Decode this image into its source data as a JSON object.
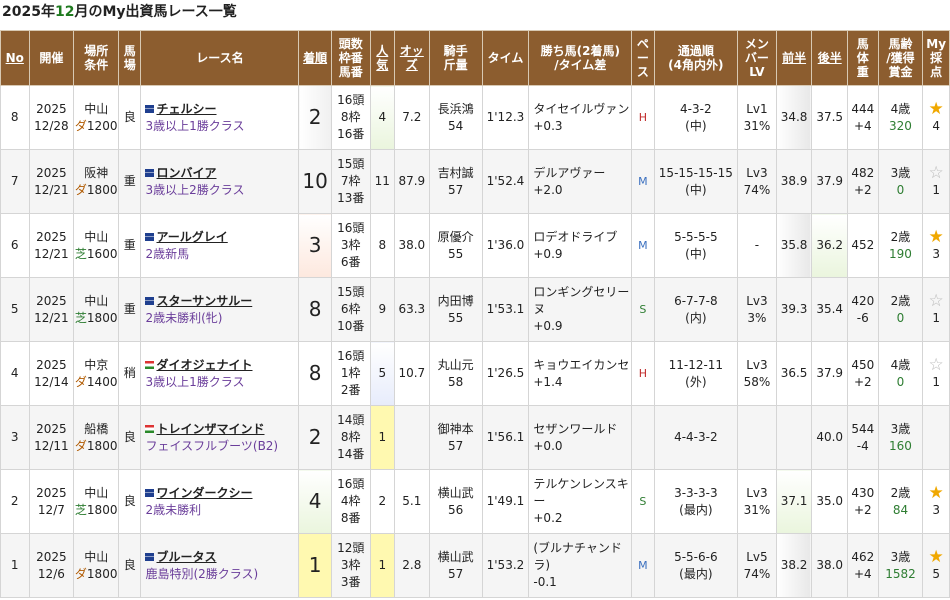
{
  "page": {
    "title_prefix": "2025年",
    "title_month": "12",
    "title_suffix": "月のMy出資馬レース一覧"
  },
  "headers": [
    "No",
    "開催",
    "場所\n条件",
    "馬\n場",
    "レース名",
    "着順",
    "頭数\n枠番\n馬番",
    "人\n気",
    "オッ\nズ",
    "騎手\n斤量",
    "タイム",
    "勝ち馬(2着馬)\n/タイム差",
    "ペ\nー\nス",
    "通過順\n(4角内外)",
    "メン\nバー\nLV",
    "前半",
    "後半",
    "馬\n体\n重",
    "馬齢\n/獲得\n賞金",
    "My\n採\n点"
  ],
  "rows": [
    {
      "no": "8",
      "year": "2025",
      "date": "12/28",
      "place": "中山",
      "surface": "ダ",
      "dist": "1200",
      "baba": "良",
      "flag": "blue",
      "name": "チェルシー",
      "cls": "3歳以上1勝クラス",
      "chaku": "2",
      "chaku_bg": "grad",
      "tosu": "16頭",
      "waku": "8枠",
      "uma": "16番",
      "ninki": "4",
      "ninki_bg": "lg",
      "odds": "7.2",
      "jockey": "長浜鴻",
      "kinryo": "54",
      "time": "1'12.3",
      "winner": "タイセイルヴァン",
      "diff": "+0.3",
      "pace": "H",
      "tsuka": "4-3-2",
      "naigai": "(中)",
      "lv": "Lv1",
      "lvp": "31%",
      "zen": "34.8",
      "zen_bg": "dg",
      "kou": "37.5",
      "kou_bg": "",
      "weight": "444",
      "wdiff": "+4",
      "age": "4歳",
      "prize": "320",
      "star": "full",
      "score": "4"
    },
    {
      "no": "7",
      "year": "2025",
      "date": "12/21",
      "place": "阪神",
      "surface": "ダ",
      "dist": "1800",
      "baba": "重",
      "flag": "blue",
      "name": "ロンバイア",
      "cls": "3歳以上2勝クラス",
      "chaku": "10",
      "chaku_bg": "",
      "tosu": "15頭",
      "waku": "7枠",
      "uma": "13番",
      "ninki": "11",
      "ninki_bg": "",
      "odds": "87.9",
      "jockey": "吉村誠",
      "kinryo": "57",
      "time": "1'52.4",
      "winner": "デルアヴァー",
      "diff": "+2.0",
      "pace": "M",
      "tsuka": "15-15-15-15",
      "naigai": "(中)",
      "lv": "Lv3",
      "lvp": "74%",
      "zen": "38.9",
      "zen_bg": "",
      "kou": "37.9",
      "kou_bg": "",
      "weight": "482",
      "wdiff": "+2",
      "age": "3歳",
      "prize": "0",
      "star": "empty",
      "score": "1"
    },
    {
      "no": "6",
      "year": "2025",
      "date": "12/21",
      "place": "中山",
      "surface": "芝",
      "dist": "1600",
      "baba": "重",
      "flag": "blue",
      "name": "アールグレイ",
      "cls": "2歳新馬",
      "chaku": "3",
      "chaku_bg": "pink",
      "tosu": "16頭",
      "waku": "3枠",
      "uma": "6番",
      "ninki": "8",
      "ninki_bg": "",
      "odds": "38.0",
      "jockey": "原優介",
      "kinryo": "55",
      "time": "1'36.0",
      "winner": "ロデオドライブ",
      "diff": "+0.9",
      "pace": "M",
      "tsuka": "5-5-5-5",
      "naigai": "(中)",
      "lv": "-",
      "lvp": "",
      "zen": "35.8",
      "zen_bg": "dg",
      "kou": "36.2",
      "kou_bg": "lg",
      "weight": "452",
      "wdiff": "",
      "age": "2歳",
      "prize": "190",
      "star": "half",
      "score": "3"
    },
    {
      "no": "5",
      "year": "2025",
      "date": "12/21",
      "place": "中山",
      "surface": "芝",
      "dist": "1800",
      "baba": "重",
      "flag": "blue",
      "name": "スターサンサルー",
      "cls": "2歳未勝利(牝)",
      "chaku": "8",
      "chaku_bg": "",
      "tosu": "15頭",
      "waku": "6枠",
      "uma": "10番",
      "ninki": "9",
      "ninki_bg": "",
      "odds": "63.3",
      "jockey": "内田博",
      "kinryo": "55",
      "time": "1'53.1",
      "winner": "ロンギングセリーヌ",
      "diff": "+0.9",
      "pace": "S",
      "tsuka": "6-7-7-8",
      "naigai": "(内)",
      "lv": "Lv3",
      "lvp": "3%",
      "zen": "39.3",
      "zen_bg": "",
      "kou": "35.4",
      "kou_bg": "",
      "weight": "420",
      "wdiff": "-6",
      "age": "2歳",
      "prize": "0",
      "star": "empty",
      "score": "1"
    },
    {
      "no": "4",
      "year": "2025",
      "date": "12/14",
      "place": "中京",
      "surface": "ダ",
      "dist": "1400",
      "baba": "稍",
      "flag": "hu",
      "name": "ダイオジェナイト",
      "cls": "3歳以上1勝クラス",
      "chaku": "8",
      "chaku_bg": "",
      "tosu": "16頭",
      "waku": "1枠",
      "uma": "2番",
      "ninki": "5",
      "ninki_bg": "blu",
      "odds": "10.7",
      "jockey": "丸山元",
      "kinryo": "58",
      "time": "1'26.5",
      "winner": "キョウエイカンセ",
      "diff": "+1.4",
      "pace": "H",
      "tsuka": "11-12-11",
      "naigai": "(外)",
      "lv": "Lv3",
      "lvp": "58%",
      "zen": "36.5",
      "zen_bg": "",
      "kou": "37.9",
      "kou_bg": "",
      "weight": "450",
      "wdiff": "+2",
      "age": "4歳",
      "prize": "0",
      "star": "empty",
      "score": "1"
    },
    {
      "no": "3",
      "year": "2025",
      "date": "12/11",
      "place": "船橋",
      "surface": "ダ",
      "dist": "1800",
      "baba": "良",
      "flag": "hu",
      "name": "トレインザマインド",
      "cls": "フェイスフルブーツ(B2)",
      "chaku": "2",
      "chaku_bg": "",
      "tosu": "14頭",
      "waku": "8枠",
      "uma": "14番",
      "ninki": "1",
      "ninki_bg": "gold",
      "odds": "",
      "jockey": "御神本",
      "kinryo": "57",
      "time": "1'56.1",
      "winner": "セザンワールド",
      "diff": "+0.0",
      "pace": "",
      "tsuka": "4-4-3-2",
      "naigai": "",
      "lv": "",
      "lvp": "",
      "zen": "",
      "zen_bg": "",
      "kou": "40.0",
      "kou_bg": "",
      "weight": "544",
      "wdiff": "-4",
      "age": "3歳",
      "prize": "160",
      "star": "",
      "score": ""
    },
    {
      "no": "2",
      "year": "2025",
      "date": "12/7",
      "place": "中山",
      "surface": "芝",
      "dist": "1800",
      "baba": "良",
      "flag": "blue",
      "name": "ワインダークシー",
      "cls": "2歳未勝利",
      "chaku": "4",
      "chaku_bg": "lg",
      "tosu": "16頭",
      "waku": "4枠",
      "uma": "8番",
      "ninki": "2",
      "ninki_bg": "",
      "odds": "5.1",
      "jockey": "横山武",
      "kinryo": "56",
      "time": "1'49.1",
      "winner": "テルケンレンスキー",
      "diff": "+0.2",
      "pace": "S",
      "tsuka": "3-3-3-3",
      "naigai": "(最内)",
      "lv": "Lv3",
      "lvp": "31%",
      "zen": "37.1",
      "zen_bg": "lg",
      "kou": "35.0",
      "kou_bg": "",
      "weight": "430",
      "wdiff": "+2",
      "age": "2歳",
      "prize": "84",
      "star": "half",
      "score": "3"
    },
    {
      "no": "1",
      "year": "2025",
      "date": "12/6",
      "place": "中山",
      "surface": "ダ",
      "dist": "1800",
      "baba": "良",
      "flag": "blue",
      "name": "ブルータス",
      "cls": "鹿島特別(2勝クラス)",
      "chaku": "1",
      "chaku_bg": "gold",
      "tosu": "12頭",
      "waku": "3枠",
      "uma": "3番",
      "ninki": "1",
      "ninki_bg": "gold",
      "odds": "2.8",
      "jockey": "横山武",
      "kinryo": "57",
      "time": "1'53.2",
      "winner": "(ブルナチャンドラ)",
      "diff": "-0.1",
      "pace": "M",
      "tsuka": "5-5-6-6",
      "naigai": "(最内)",
      "lv": "Lv5",
      "lvp": "74%",
      "zen": "38.2",
      "zen_bg": "dg",
      "kou": "38.0",
      "kou_bg": "",
      "weight": "462",
      "wdiff": "+4",
      "age": "3歳",
      "prize": "1582",
      "star": "full",
      "score": "5"
    }
  ],
  "icons": {
    "star-full": "★",
    "star-empty": "☆"
  },
  "colors": {
    "header_bg": "#8c5d2f",
    "title_green": "#1f7a1f",
    "class_purple": "#6a3d9a",
    "prize_green": "#2e7d32"
  }
}
